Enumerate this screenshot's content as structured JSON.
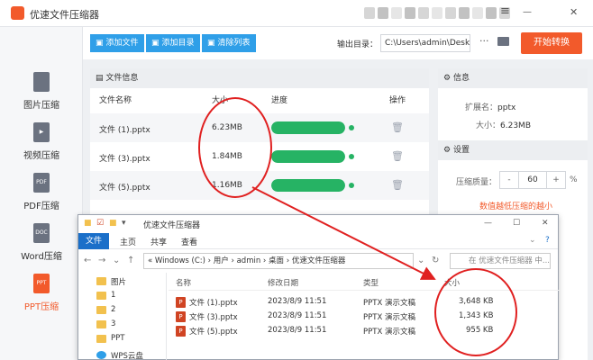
{
  "app": {
    "title": "优速文件压缩器"
  },
  "window_controls": {
    "menu": "≡",
    "minimize": "—",
    "close": "✕"
  },
  "sidebar": {
    "items": [
      {
        "label": "图片压缩",
        "icon_text": ""
      },
      {
        "label": "视频压缩",
        "icon_text": "▶"
      },
      {
        "label": "PDF压缩",
        "icon_text": "PDF"
      },
      {
        "label": "Word压缩",
        "icon_text": "DOC"
      },
      {
        "label": "PPT压缩",
        "icon_text": "PPT"
      }
    ]
  },
  "toolbar": {
    "add_file": "添加文件",
    "add_dir": "添加目录",
    "clear_list": "清除列表",
    "output_label": "输出目录：",
    "output_path": "C:\\Users\\admin\\Deskto",
    "more": "···",
    "start": "开始转换"
  },
  "file_panel": {
    "heading": "文件信息",
    "columns": {
      "name": "文件名称",
      "size": "大小",
      "progress": "进度",
      "action": "操作"
    },
    "rows": [
      {
        "name": "文件 (1).pptx",
        "size": "6.23MB",
        "progress": 1.0
      },
      {
        "name": "文件 (3).pptx",
        "size": "1.84MB",
        "progress": 1.0
      },
      {
        "name": "文件 (5).pptx",
        "size": "1.16MB",
        "progress": 1.0
      }
    ]
  },
  "info_panel": {
    "heading": "信息",
    "ext_label": "扩展名：",
    "ext_value": "pptx",
    "size_label": "大小：",
    "size_value": "6.23MB",
    "settings_heading": "设置",
    "quality_label": "压缩质量：",
    "quality_value": "60",
    "quality_unit": "%",
    "minus": "-",
    "plus": "+",
    "hint": "数值越低压缩的越小"
  },
  "explorer": {
    "title": "优速文件压缩器",
    "menu": [
      "文件",
      "主页",
      "共享",
      "查看"
    ],
    "address": "«  Windows (C:)  ›  用户  ›  admin  ›  桌面  ›  优速文件压缩器",
    "search_placeholder": "在 优速文件压缩器 中...",
    "tree": [
      "图片",
      "1",
      "2",
      "3",
      "PPT",
      "WPS云盘"
    ],
    "columns": {
      "name": "名称",
      "date": "修改日期",
      "type": "类型",
      "size": "大小"
    },
    "files": [
      {
        "name": "文件 (1).pptx",
        "date": "2023/8/9 11:51",
        "type": "PPTX 演示文稿",
        "size": "3,648 KB"
      },
      {
        "name": "文件 (3).pptx",
        "date": "2023/8/9 11:51",
        "type": "PPTX 演示文稿",
        "size": "1,343 KB"
      },
      {
        "name": "文件 (5).pptx",
        "date": "2023/8/9 11:51",
        "type": "PPTX 演示文稿",
        "size": "955 KB"
      }
    ]
  },
  "colors": {
    "accent": "#f25a2b",
    "primary_blue": "#2f9fe8",
    "progress_green": "#26b364",
    "annotation_red": "#e02020"
  }
}
